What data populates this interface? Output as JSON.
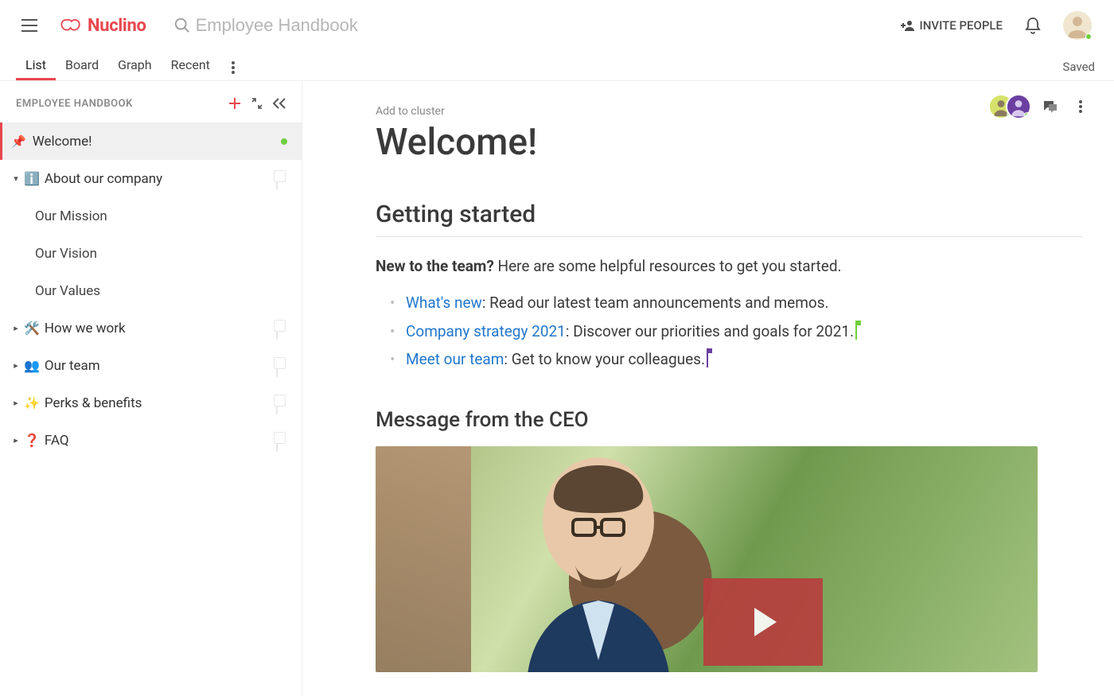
{
  "app": {
    "name": "Nuclino",
    "search_placeholder": "Employee Handbook",
    "invite_label": "INVITE PEOPLE",
    "saved_label": "Saved"
  },
  "tabs": {
    "items": [
      "List",
      "Board",
      "Graph",
      "Recent"
    ],
    "active_index": 0
  },
  "sidebar": {
    "title": "EMPLOYEE HANDBOOK",
    "nodes": [
      {
        "id": "welcome",
        "emoji": "📌",
        "label": "Welcome!",
        "pinned": true,
        "active": true,
        "presence": true
      },
      {
        "id": "about",
        "emoji": "ℹ️",
        "label": "About our company",
        "expanded": true,
        "children": [
          {
            "id": "mission",
            "label": "Our Mission"
          },
          {
            "id": "vision",
            "label": "Our Vision"
          },
          {
            "id": "values",
            "label": "Our Values"
          }
        ]
      },
      {
        "id": "how",
        "emoji": "🛠️",
        "label": "How we work"
      },
      {
        "id": "team",
        "emoji": "👥",
        "label": "Our team"
      },
      {
        "id": "perks",
        "emoji": "✨",
        "label": "Perks & benefits"
      },
      {
        "id": "faq",
        "emoji": "❓",
        "label": "FAQ"
      }
    ]
  },
  "document": {
    "cluster_hint": "Add to cluster",
    "title": "Welcome!",
    "section1_heading": "Getting started",
    "intro_strong": "New to the team?",
    "intro_rest": " Here are some helpful resources to get you started.",
    "bullets": [
      {
        "link": "What's new",
        "text": ": Read our latest team announcements and memos."
      },
      {
        "link": "Company strategy 2021",
        "text": ": Discover our priorities and goals for 2021.",
        "cursor": "green"
      },
      {
        "link": "Meet our team",
        "text": ": Get to know your colleagues.",
        "cursor": "purple"
      }
    ],
    "section2_heading": "Message from the CEO"
  },
  "colors": {
    "brand": "#e8464d",
    "link": "#2277cc",
    "presence": "#6fcf3c"
  }
}
